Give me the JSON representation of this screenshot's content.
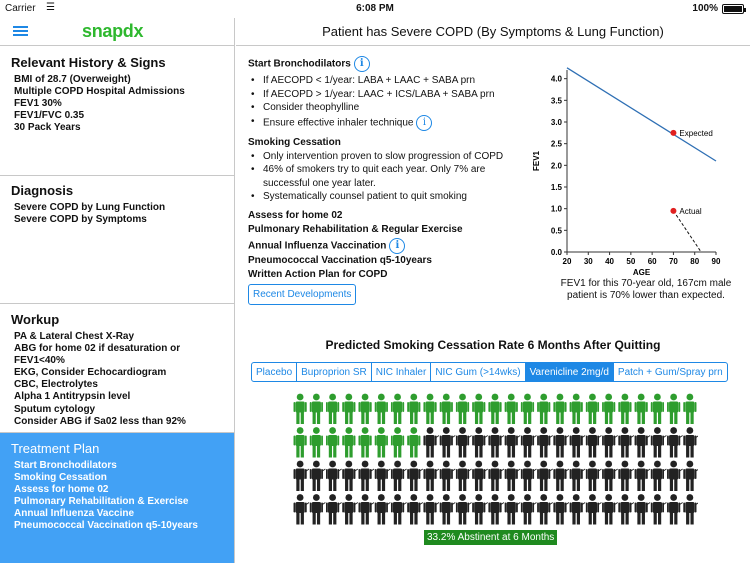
{
  "status": {
    "carrier": "Carrier",
    "time": "6:08 PM",
    "battery": "100%"
  },
  "sidebar": {
    "logo": "snapdx",
    "history": {
      "title": "Relevant History & Signs",
      "items": [
        "BMI of 28.7 (Overweight)",
        "Multiple COPD Hospital Admissions",
        "FEV1 30%",
        "FEV1/FVC 0.35",
        "30 Pack Years"
      ]
    },
    "diagnosis": {
      "title": "Diagnosis",
      "items": [
        "Severe COPD by Lung Function",
        "Severe COPD by Symptoms"
      ]
    },
    "workup": {
      "title": "Workup",
      "items": [
        "PA & Lateral Chest X-Ray",
        "ABG for home 02 if desaturation or",
        "FEV1<40%",
        "EKG, Consider Echocardiogram",
        "CBC, Electrolytes",
        "Alpha 1 Antitrypsin level",
        "Sputum cytology",
        "Consider ABG if Sa02 less than 92%"
      ]
    },
    "treatment": {
      "title": "Treatment Plan",
      "items": [
        "Start Bronchodilators",
        "Smoking Cessation",
        "Assess for home 02",
        "Pulmonary Rehabilitation & Exercise",
        "Annual Influenza Vaccine",
        "Pneumococcal Vaccination q5-10years"
      ]
    }
  },
  "main": {
    "title": "Patient has Severe COPD (By Symptoms & Lung Function)",
    "bronchodilators": {
      "head": "Start Bronchodilators",
      "items": [
        "If AECOPD < 1/year: LABA + LAAC + SABA prn",
        "If AECOPD > 1/year: LAAC + ICS/LABA + SABA prn",
        "Consider theophylline",
        "Ensure effective inhaler technique"
      ]
    },
    "smoking": {
      "head": "Smoking Cessation",
      "items": [
        "Only intervention proven to slow progression of COPD",
        "46% of smokers try to quit each year. Only 7% are",
        "successful one year later.",
        "Systematically counsel patient to quit smoking"
      ]
    },
    "assess_o2": "Assess for home 02",
    "pulm_rehab": "Pulmonary Rehabilitation & Regular Exercise",
    "influenza": "Annual Influenza Vaccination",
    "pneumococcal": "Pneumococcal Vaccination q5-10years",
    "action_plan": "Written Action Plan for COPD",
    "recent_button": "Recent Developments",
    "info_glyph": "i",
    "chart_caption": "FEV1 for this 70-year old, 167cm male patient is 70% lower than expected.",
    "cessation": {
      "title": "Predicted Smoking Cessation Rate 6 Months After Quitting",
      "tabs": [
        "Placebo",
        "Buproprion SR",
        "NIC Inhaler",
        "NIC Gum (>14wks)",
        "Varenicline 2mg/d",
        "Patch + Gum/Spray prn"
      ],
      "active_tab": 4,
      "abstinent_percent": 33.2,
      "result": "33.2% Abstinent at 6 Months",
      "green": "#2e9d2e",
      "black": "#222222"
    }
  },
  "chart_data": {
    "type": "line",
    "xlabel": "AGE",
    "ylabel": "FEV1",
    "xlim": [
      20,
      90
    ],
    "ylim": [
      0,
      4.2
    ],
    "xticks": [
      20,
      30,
      40,
      50,
      60,
      70,
      80,
      90
    ],
    "yticks": [
      0.0,
      0.5,
      1.0,
      1.5,
      2.0,
      2.5,
      3.0,
      3.5,
      4.0
    ],
    "expected_line": {
      "x": [
        20,
        90
      ],
      "y": [
        4.25,
        2.1
      ]
    },
    "points": [
      {
        "label": "Expected",
        "x": 70,
        "y": 2.75
      },
      {
        "label": "Actual",
        "x": 70,
        "y": 0.95
      }
    ],
    "decline_projection": {
      "x": [
        70,
        83
      ],
      "y": [
        0.95,
        0.0
      ]
    },
    "line_color": "#2e6fb4",
    "point_color": "#e02020"
  }
}
